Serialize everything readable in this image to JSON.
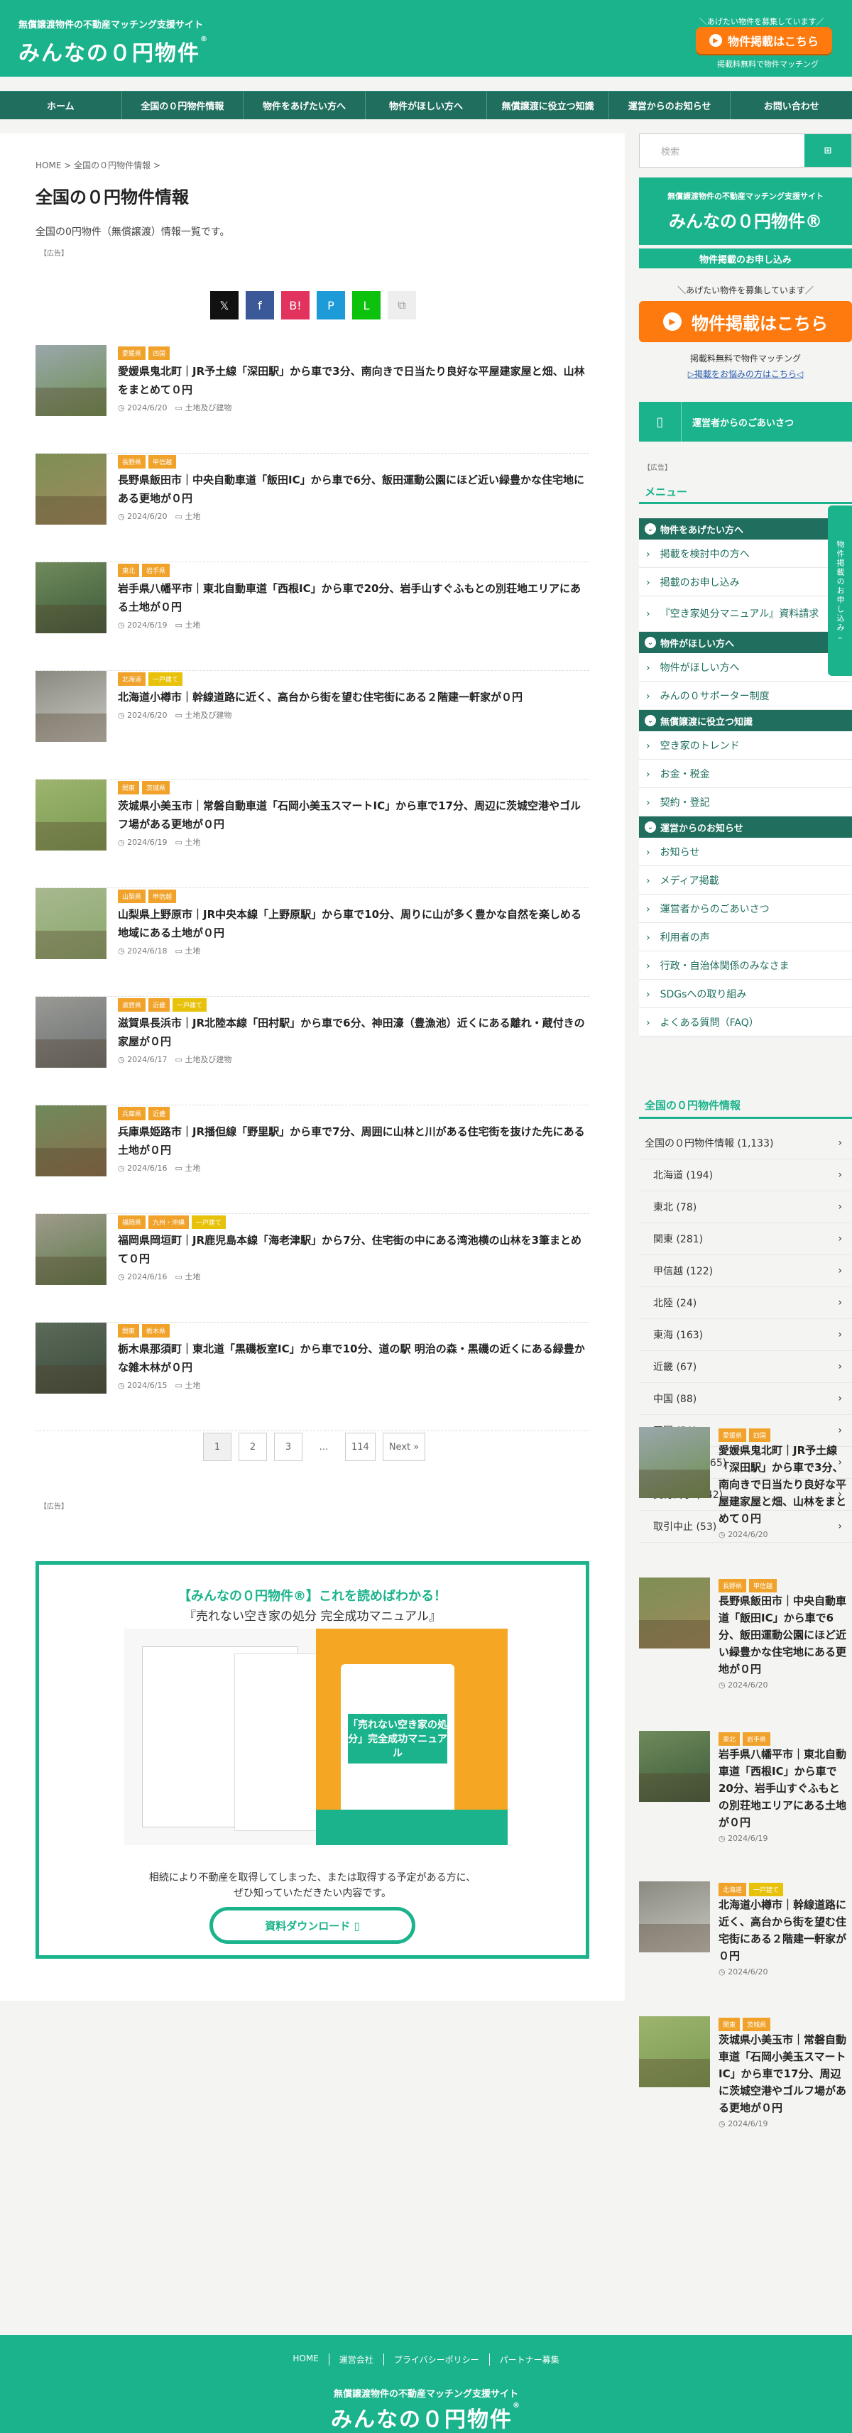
{
  "header": {
    "tagline": "無償譲渡物件の不動産マッチング支援サイト",
    "logo": "みんなの０円物件",
    "logo_mark": "®",
    "cta_note": "＼あげたい物件を募集しています／",
    "cta_label": "物件掲載はこちら",
    "cta_foot": "掲載料無料で物件マッチング"
  },
  "nav": [
    "ホーム",
    "全国の０円物件情報",
    "物件をあげたい方へ",
    "物件がほしい方へ",
    "無償譲渡に役立つ知識",
    "運営からのお知らせ",
    "お問い合わせ"
  ],
  "main": {
    "breadcrumb": "HOME > 全国の０円物件情報 >",
    "title": "全国の０円物件情報",
    "description": "全国の0円物件（無償譲渡）情報一覧です。",
    "ad_label": "【広告】",
    "share_icons": [
      {
        "name": "x-icon",
        "glyph": "𝕏",
        "color": "#111111"
      },
      {
        "name": "facebook-icon",
        "glyph": "f",
        "color": "#3b5998"
      },
      {
        "name": "hatena-icon",
        "glyph": "B!",
        "color": "#e2325e"
      },
      {
        "name": "pocket-icon",
        "glyph": "P",
        "color": "#1d9bd9"
      },
      {
        "name": "line-icon",
        "glyph": "L",
        "color": "#0cc20c"
      },
      {
        "name": "copy-icon",
        "glyph": "⧉",
        "color": "#eeeeee"
      }
    ],
    "posts": [
      {
        "tags": [
          "愛媛県",
          "四国"
        ],
        "title": "愛媛県鬼北町｜JR予土線「深田駅」から車で3分、南向きで日当たり良好な平屋建家屋と畑、山林をまとめて０円",
        "date": "2024/6/20",
        "cat": "土地及び建物",
        "c1": "#6d8e4f",
        "c2": "#9aa7ac"
      },
      {
        "tags": [
          "長野県",
          "甲信越"
        ],
        "title": "長野県飯田市｜中央自動車道「飯田IC」から車で6分、飯田運動公園にほど近い緑豊かな住宅地にある更地が０円",
        "date": "2024/6/20",
        "cat": "土地",
        "c1": "#a08a5c",
        "c2": "#7d8f55"
      },
      {
        "tags": [
          "東北",
          "岩手県"
        ],
        "title": "岩手県八幡平市｜東北自動車道「西根IC」から車で20分、岩手山すぐふもとの別荘地エリアにある土地が０円",
        "date": "2024/6/19",
        "cat": "土地",
        "c1": "#3d5a3a",
        "c2": "#6f8a5b"
      },
      {
        "tags": [
          "北海道",
          "一戸建て"
        ],
        "title": "北海道小樽市｜幹線道路に近く、高台から街を望む住宅街にある２階建一軒家が０円",
        "date": "2024/6/20",
        "cat": "土地及び建物",
        "c1": "#c9c9c4",
        "c2": "#8a8a80"
      },
      {
        "tags": [
          "関東",
          "茨城県"
        ],
        "title": "茨城県小美玉市｜常磐自動車道「石岡小美玉スマートIC」から車で17分、周辺に茨城空港やゴルフ場がある更地が０円",
        "date": "2024/6/19",
        "cat": "土地",
        "c1": "#7a9a50",
        "c2": "#9db46e"
      },
      {
        "tags": [
          "山梨県",
          "甲信越"
        ],
        "title": "山梨県上野原市｜JR中央本線「上野原駅」から車で10分、周りに山が多く豊かな自然を楽しめる地域にある土地が０円",
        "date": "2024/6/18",
        "cat": "土地",
        "c1": "#8aa86a",
        "c2": "#a8b890"
      },
      {
        "tags": [
          "滋賀県",
          "近畿",
          "一戸建て"
        ],
        "title": "滋賀県長浜市｜JR北陸本線「田村駅」から車で6分、神田濠（豊漁池）近くにある離れ・蔵付きの家屋が０円",
        "date": "2024/6/17",
        "cat": "土地及び建物",
        "c1": "#6a6f70",
        "c2": "#9a9a95"
      },
      {
        "tags": [
          "兵庫県",
          "近畿"
        ],
        "title": "兵庫県姫路市｜JR播但線「野里駅」から車で7分、周囲に山林と川がある住宅街を抜けた先にある土地が０円",
        "date": "2024/6/16",
        "cat": "土地",
        "c1": "#8a6d4a",
        "c2": "#6f8a5b"
      },
      {
        "tags": [
          "福岡県",
          "九州・沖縄",
          "一戸建て"
        ],
        "title": "福岡県岡垣町｜JR鹿児島本線「海老津駅」から7分、住宅街の中にある湾池横の山林を3筆まとめて０円",
        "date": "2024/6/16",
        "cat": "土地",
        "c1": "#5b7a48",
        "c2": "#a09b8c"
      },
      {
        "tags": [
          "関東",
          "栃木県"
        ],
        "title": "栃木県那須町｜東北道「黒磯板室IC」から車で10分、道の駅 明治の森・黒磯の近くにある緑豊かな雑木林が０円",
        "date": "2024/6/15",
        "cat": "土地",
        "c1": "#3a4a3a",
        "c2": "#5c6a5a"
      }
    ],
    "pagination": {
      "pages": [
        "1",
        "2",
        "3"
      ],
      "ellipsis": "…",
      "last": "114",
      "next": "Next »"
    },
    "promo": {
      "heading": "【みんなの０円物件®】これを読めばわかる！",
      "subheading": "『売れない空き家の処分 完全成功マニュアル』",
      "book_title": "「売れない空き家の処分」完全成功マニュアル",
      "text_line1": "相続により不動産を取得してしまった、または取得する予定がある方に、",
      "text_line2": "ぜひ知っていただきたい内容です。",
      "button": "資料ダウンロード ▯"
    }
  },
  "sidebar": {
    "search_placeholder": "検索",
    "search_icon": "⊞",
    "banner_sub": "無償譲渡物件の不動産マッチング支援サイト",
    "banner_main": "みんなの０円物件®",
    "banner_apply": "物件掲載のお申し込み",
    "cta_note": "＼あげたい物件を募集しています／",
    "cta_label": "物件掲載はこちら",
    "free_text": "掲載料無料で物件マッチング",
    "consult_link": "▷掲載をお悩みの方はこちら◁",
    "greeting": "運営者からのごあいさつ",
    "ad_label": "【広告】",
    "menu_title": "メニュー",
    "menu": [
      {
        "cat": "物件をあげたい方へ",
        "items": [
          "掲載を検討中の方へ",
          "掲載のお申し込み",
          "『空き家処分マニュアル』資料請求"
        ]
      },
      {
        "cat": "物件がほしい方へ",
        "items": [
          "物件がほしい方へ",
          "みんの０サポーター制度"
        ]
      },
      {
        "cat": "無償譲渡に役立つ知識",
        "items": [
          "空き家のトレンド",
          "お金・税金",
          "契約・登記"
        ]
      },
      {
        "cat": "運営からのお知らせ",
        "items": [
          "お知らせ",
          "メディア掲載",
          "運営者からのごあいさつ",
          "利用者の声",
          "行政・自治体関係のみなさま",
          "SDGsへの取り組み",
          "よくある質問（FAQ）"
        ]
      }
    ],
    "archive_title": "全国の０円物件情報",
    "archive": [
      {
        "label": "全国の０円物件情報 (1,133)",
        "sub": false
      },
      {
        "label": "北海道 (194)",
        "sub": true
      },
      {
        "label": "東北 (78)",
        "sub": true
      },
      {
        "label": "関東 (281)",
        "sub": true
      },
      {
        "label": "甲信越 (122)",
        "sub": true
      },
      {
        "label": "北陸 (24)",
        "sub": true
      },
      {
        "label": "東海 (163)",
        "sub": true
      },
      {
        "label": "近畿 (67)",
        "sub": true
      },
      {
        "label": "中国 (88)",
        "sub": true
      },
      {
        "label": "四国 (50)",
        "sub": true
      },
      {
        "label": "九州・沖縄 (65)",
        "sub": true
      },
      {
        "label": "受付終了 (842)",
        "sub": true
      },
      {
        "label": "取引中止 (53)",
        "sub": true
      }
    ],
    "recent": [
      {
        "tags": [
          "愛媛県",
          "四国"
        ],
        "title": "愛媛県鬼北町｜JR予土線「深田駅」から車で3分、南向きで日当たり良好な平屋建家屋と畑、山林をまとめて０円",
        "date": "2024/6/20",
        "c1": "#6d8e4f",
        "c2": "#9aa7ac"
      },
      {
        "tags": [
          "長野県",
          "甲信越"
        ],
        "title": "長野県飯田市｜中央自動車道「飯田IC」から車で6分、飯田運動公園にほど近い緑豊かな住宅地にある更地が０円",
        "date": "2024/6/20",
        "c1": "#a08a5c",
        "c2": "#7d8f55"
      },
      {
        "tags": [
          "東北",
          "岩手県"
        ],
        "title": "岩手県八幡平市｜東北自動車道「西根IC」から車で20分、岩手山すぐふもとの別荘地エリアにある土地が０円",
        "date": "2024/6/19",
        "c1": "#3d5a3a",
        "c2": "#6f8a5b"
      },
      {
        "tags": [
          "北海道",
          "一戸建て"
        ],
        "title": "北海道小樽市｜幹線道路に近く、高台から街を望む住宅街にある２階建一軒家が０円",
        "date": "2024/6/20",
        "c1": "#c9c9c4",
        "c2": "#8a8a80"
      },
      {
        "tags": [
          "関東",
          "茨城県"
        ],
        "title": "茨城県小美玉市｜常磐自動車道「石岡小美玉スマートIC」から車で17分、周辺に茨城空港やゴルフ場がある更地が０円",
        "date": "2024/6/19",
        "c1": "#7a9a50",
        "c2": "#9db46e"
      }
    ],
    "fixed_tab": "物件掲載のお申し込み ‹"
  },
  "footer": {
    "links": [
      "HOME",
      "運営会社",
      "プライバシーポリシー",
      "パートナー募集"
    ],
    "tagline": "無償譲渡物件の不動産マッチング支援サイト",
    "logo": "みんなの０円物件",
    "logo_mark": "®"
  },
  "colors": {
    "brand": "#1ab38c",
    "nav": "#1f6e5e",
    "cta": "#ff7a0e",
    "tag": "#f0a22a",
    "tag_alt": "#e8c20a"
  }
}
